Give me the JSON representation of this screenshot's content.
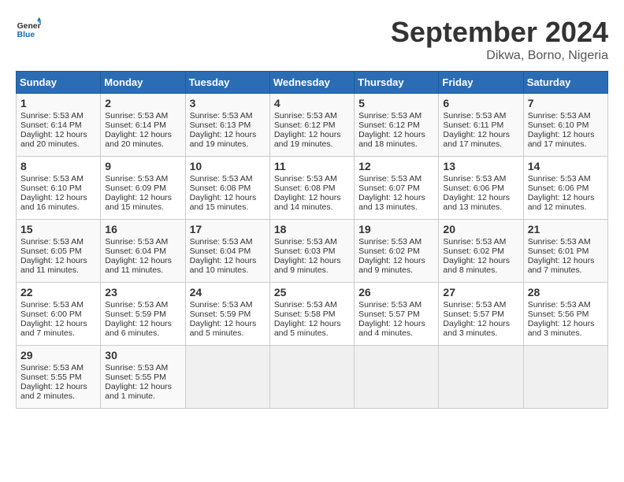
{
  "header": {
    "logo_general": "General",
    "logo_blue": "Blue",
    "month": "September 2024",
    "location": "Dikwa, Borno, Nigeria"
  },
  "days_of_week": [
    "Sunday",
    "Monday",
    "Tuesday",
    "Wednesday",
    "Thursday",
    "Friday",
    "Saturday"
  ],
  "weeks": [
    [
      {
        "day": "1",
        "sunrise": "5:53 AM",
        "sunset": "6:14 PM",
        "daylight": "12 hours and 20 minutes."
      },
      {
        "day": "2",
        "sunrise": "5:53 AM",
        "sunset": "6:14 PM",
        "daylight": "12 hours and 20 minutes."
      },
      {
        "day": "3",
        "sunrise": "5:53 AM",
        "sunset": "6:13 PM",
        "daylight": "12 hours and 19 minutes."
      },
      {
        "day": "4",
        "sunrise": "5:53 AM",
        "sunset": "6:12 PM",
        "daylight": "12 hours and 19 minutes."
      },
      {
        "day": "5",
        "sunrise": "5:53 AM",
        "sunset": "6:12 PM",
        "daylight": "12 hours and 18 minutes."
      },
      {
        "day": "6",
        "sunrise": "5:53 AM",
        "sunset": "6:11 PM",
        "daylight": "12 hours and 17 minutes."
      },
      {
        "day": "7",
        "sunrise": "5:53 AM",
        "sunset": "6:10 PM",
        "daylight": "12 hours and 17 minutes."
      }
    ],
    [
      {
        "day": "8",
        "sunrise": "5:53 AM",
        "sunset": "6:10 PM",
        "daylight": "12 hours and 16 minutes."
      },
      {
        "day": "9",
        "sunrise": "5:53 AM",
        "sunset": "6:09 PM",
        "daylight": "12 hours and 15 minutes."
      },
      {
        "day": "10",
        "sunrise": "5:53 AM",
        "sunset": "6:08 PM",
        "daylight": "12 hours and 15 minutes."
      },
      {
        "day": "11",
        "sunrise": "5:53 AM",
        "sunset": "6:08 PM",
        "daylight": "12 hours and 14 minutes."
      },
      {
        "day": "12",
        "sunrise": "5:53 AM",
        "sunset": "6:07 PM",
        "daylight": "12 hours and 13 minutes."
      },
      {
        "day": "13",
        "sunrise": "5:53 AM",
        "sunset": "6:06 PM",
        "daylight": "12 hours and 13 minutes."
      },
      {
        "day": "14",
        "sunrise": "5:53 AM",
        "sunset": "6:06 PM",
        "daylight": "12 hours and 12 minutes."
      }
    ],
    [
      {
        "day": "15",
        "sunrise": "5:53 AM",
        "sunset": "6:05 PM",
        "daylight": "12 hours and 11 minutes."
      },
      {
        "day": "16",
        "sunrise": "5:53 AM",
        "sunset": "6:04 PM",
        "daylight": "12 hours and 11 minutes."
      },
      {
        "day": "17",
        "sunrise": "5:53 AM",
        "sunset": "6:04 PM",
        "daylight": "12 hours and 10 minutes."
      },
      {
        "day": "18",
        "sunrise": "5:53 AM",
        "sunset": "6:03 PM",
        "daylight": "12 hours and 9 minutes."
      },
      {
        "day": "19",
        "sunrise": "5:53 AM",
        "sunset": "6:02 PM",
        "daylight": "12 hours and 9 minutes."
      },
      {
        "day": "20",
        "sunrise": "5:53 AM",
        "sunset": "6:02 PM",
        "daylight": "12 hours and 8 minutes."
      },
      {
        "day": "21",
        "sunrise": "5:53 AM",
        "sunset": "6:01 PM",
        "daylight": "12 hours and 7 minutes."
      }
    ],
    [
      {
        "day": "22",
        "sunrise": "5:53 AM",
        "sunset": "6:00 PM",
        "daylight": "12 hours and 7 minutes."
      },
      {
        "day": "23",
        "sunrise": "5:53 AM",
        "sunset": "5:59 PM",
        "daylight": "12 hours and 6 minutes."
      },
      {
        "day": "24",
        "sunrise": "5:53 AM",
        "sunset": "5:59 PM",
        "daylight": "12 hours and 5 minutes."
      },
      {
        "day": "25",
        "sunrise": "5:53 AM",
        "sunset": "5:58 PM",
        "daylight": "12 hours and 5 minutes."
      },
      {
        "day": "26",
        "sunrise": "5:53 AM",
        "sunset": "5:57 PM",
        "daylight": "12 hours and 4 minutes."
      },
      {
        "day": "27",
        "sunrise": "5:53 AM",
        "sunset": "5:57 PM",
        "daylight": "12 hours and 3 minutes."
      },
      {
        "day": "28",
        "sunrise": "5:53 AM",
        "sunset": "5:56 PM",
        "daylight": "12 hours and 3 minutes."
      }
    ],
    [
      {
        "day": "29",
        "sunrise": "5:53 AM",
        "sunset": "5:55 PM",
        "daylight": "12 hours and 2 minutes."
      },
      {
        "day": "30",
        "sunrise": "5:53 AM",
        "sunset": "5:55 PM",
        "daylight": "12 hours and 1 minute."
      },
      null,
      null,
      null,
      null,
      null
    ]
  ]
}
